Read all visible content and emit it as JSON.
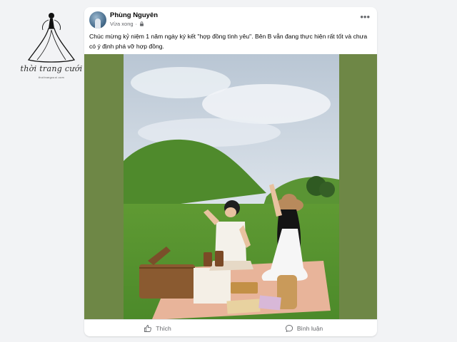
{
  "watermark": {
    "brand": "thời trang cưới",
    "url": "thoitrangcuoi.com"
  },
  "post": {
    "author": "Phùng Nguyên",
    "time": "Vừa xong",
    "privacy_icon": "lock-icon",
    "menu_icon": "more-options-icon",
    "text": "Chúc mừng kỷ niệm 1 năm ngày ký kết \"hợp đồng tình yêu\". Bên B vẫn đang thực hiện rất tốt và chưa có ý định phá vỡ hợp đồng.",
    "photo_side_color": "#6e8746"
  },
  "actions": {
    "like_label": "Thích",
    "comment_label": "Bình luận",
    "like_icon": "thumbs-up-icon",
    "comment_icon": "comment-bubble-icon"
  }
}
